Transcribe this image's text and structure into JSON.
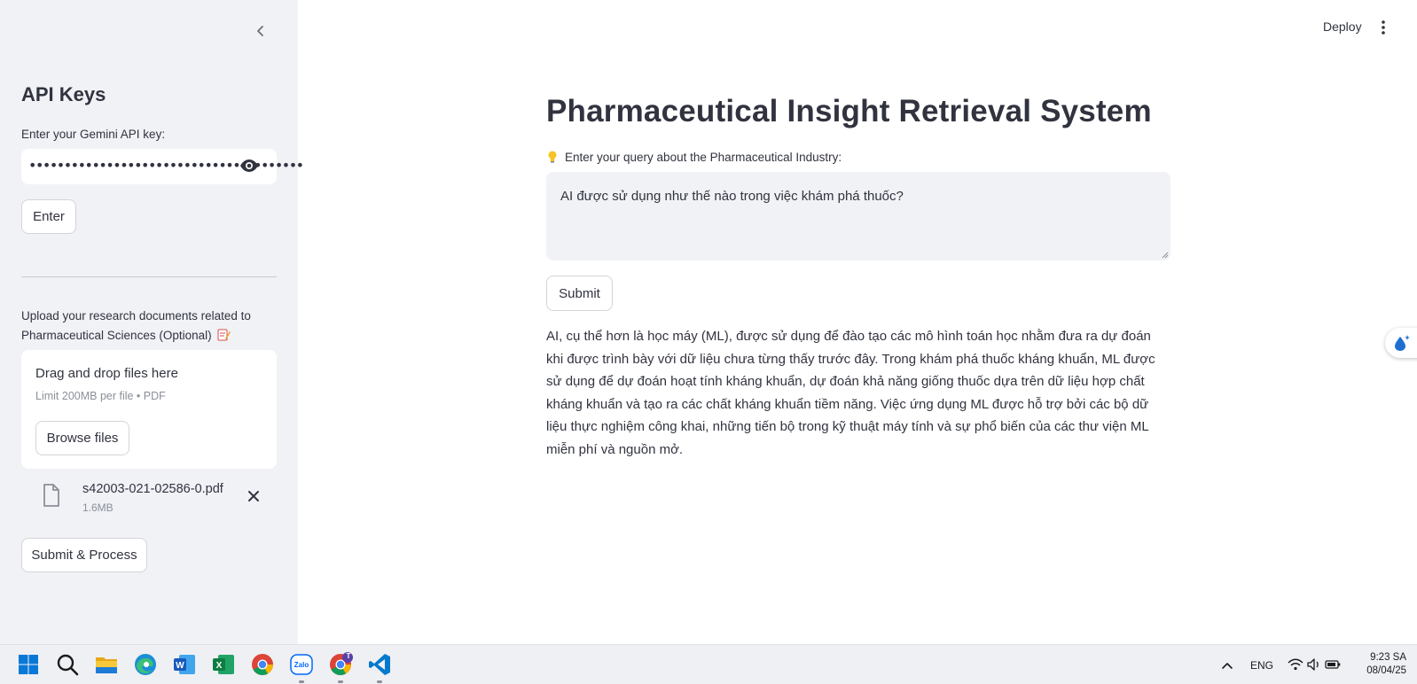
{
  "sidebar": {
    "title": "API Keys",
    "api_key_label": "Enter your Gemini API key:",
    "api_key_value": "•••••••••••••••••••••••••••••••••••••••",
    "enter_button": "Enter",
    "upload_label": "Upload your research documents related to Pharmaceutical Sciences (Optional)",
    "dropzone_title": "Drag and drop files here",
    "dropzone_limit": "Limit 200MB per file • PDF",
    "browse_button": "Browse files",
    "file": {
      "name": "s42003-021-02586-0.pdf",
      "size": "1.6MB"
    },
    "submit_process_button": "Submit & Process"
  },
  "header": {
    "deploy_label": "Deploy"
  },
  "main": {
    "title": "Pharmaceutical Insight Retrieval System",
    "query_label": "Enter your query about the Pharmaceutical Industry:",
    "query_value": "AI được sử dụng như thế nào trong việc khám phá thuốc?",
    "submit_button": "Submit",
    "answer": "AI, cụ thể hơn là học máy (ML), được sử dụng để đào tạo các mô hình toán học nhằm đưa ra dự đoán khi được trình bày với dữ liệu chưa từng thấy trước đây. Trong khám phá thuốc kháng khuẩn, ML được sử dụng để dự đoán hoạt tính kháng khuẩn, dự đoán khả năng giống thuốc dựa trên dữ liệu hợp chất kháng khuẩn và tạo ra các chất kháng khuẩn tiềm năng. Việc ứng dụng ML được hỗ trợ bởi các bộ dữ liệu thực nghiệm công khai, những tiến bộ trong kỹ thuật máy tính và sự phổ biến của các thư viện ML miễn phí và nguồn mở."
  },
  "taskbar": {
    "apps": [
      "windows-start",
      "search",
      "file-explorer",
      "edge",
      "word",
      "excel",
      "chrome",
      "zalo",
      "chrome-profile",
      "vscode"
    ],
    "chrome_profile_badge": "T",
    "language": "ENG",
    "time": "9:23 SA",
    "date": "08/04/25"
  },
  "colors": {
    "sidebar_bg": "#f0f2f6",
    "text": "#31333f",
    "accent": "#ff4b4b"
  }
}
